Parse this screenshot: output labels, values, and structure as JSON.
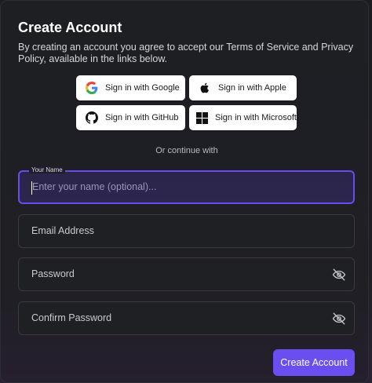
{
  "header": {
    "title": "Create Account",
    "subtitle": "By creating an account you agree to accept our Terms of Service and Privacy Policy, available in the links below."
  },
  "social": {
    "google": "Sign in with Google",
    "apple": "Sign in with Apple",
    "github": "Sign in with GitHub",
    "microsoft": "Sign in with Microsoft"
  },
  "divider": "Or continue with",
  "form": {
    "name_label": "Your Name",
    "name_placeholder": "Enter your name (optional)...",
    "email_placeholder": "Email Address",
    "password_placeholder": "Password",
    "confirm_placeholder": "Confirm Password",
    "submit_label": "Create Account"
  },
  "colors": {
    "accent": "#6b4ef0",
    "background": "#1e1f23",
    "button_bg": "#ffffff"
  },
  "icons": [
    "google-icon",
    "apple-icon",
    "github-icon",
    "microsoft-icon",
    "eye-off-icon"
  ]
}
